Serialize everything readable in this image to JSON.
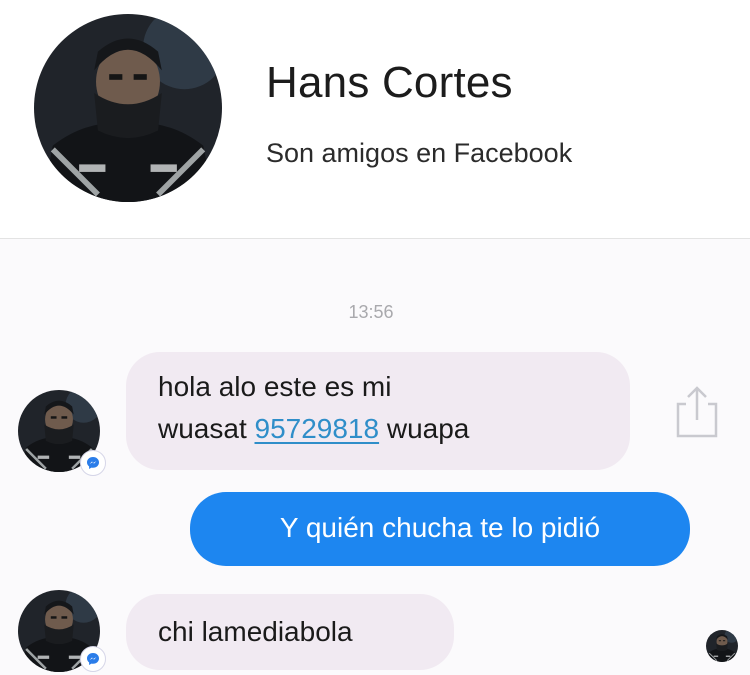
{
  "header": {
    "contact_name": "Hans Cortes",
    "friend_status": "Son amigos en Facebook"
  },
  "thread": {
    "timestamp": "13:56",
    "messages": [
      {
        "direction": "incoming",
        "line1": "hola alo este es mi",
        "line2_before": "wuasat ",
        "phone": "95729818",
        "line2_after": " wuapa"
      },
      {
        "direction": "outgoing",
        "text": "Y quién chucha te lo pidió"
      },
      {
        "direction": "incoming",
        "text": "chi lamediabola"
      }
    ]
  },
  "colors": {
    "outgoing_bubble": "#1d86f0",
    "incoming_bubble": "#f1eaf2",
    "link": "#2f8ec9",
    "messenger_badge": "#2b7de9"
  },
  "icons": [
    "avatar",
    "messenger-badge-icon",
    "share-icon",
    "read-receipt-avatar"
  ]
}
